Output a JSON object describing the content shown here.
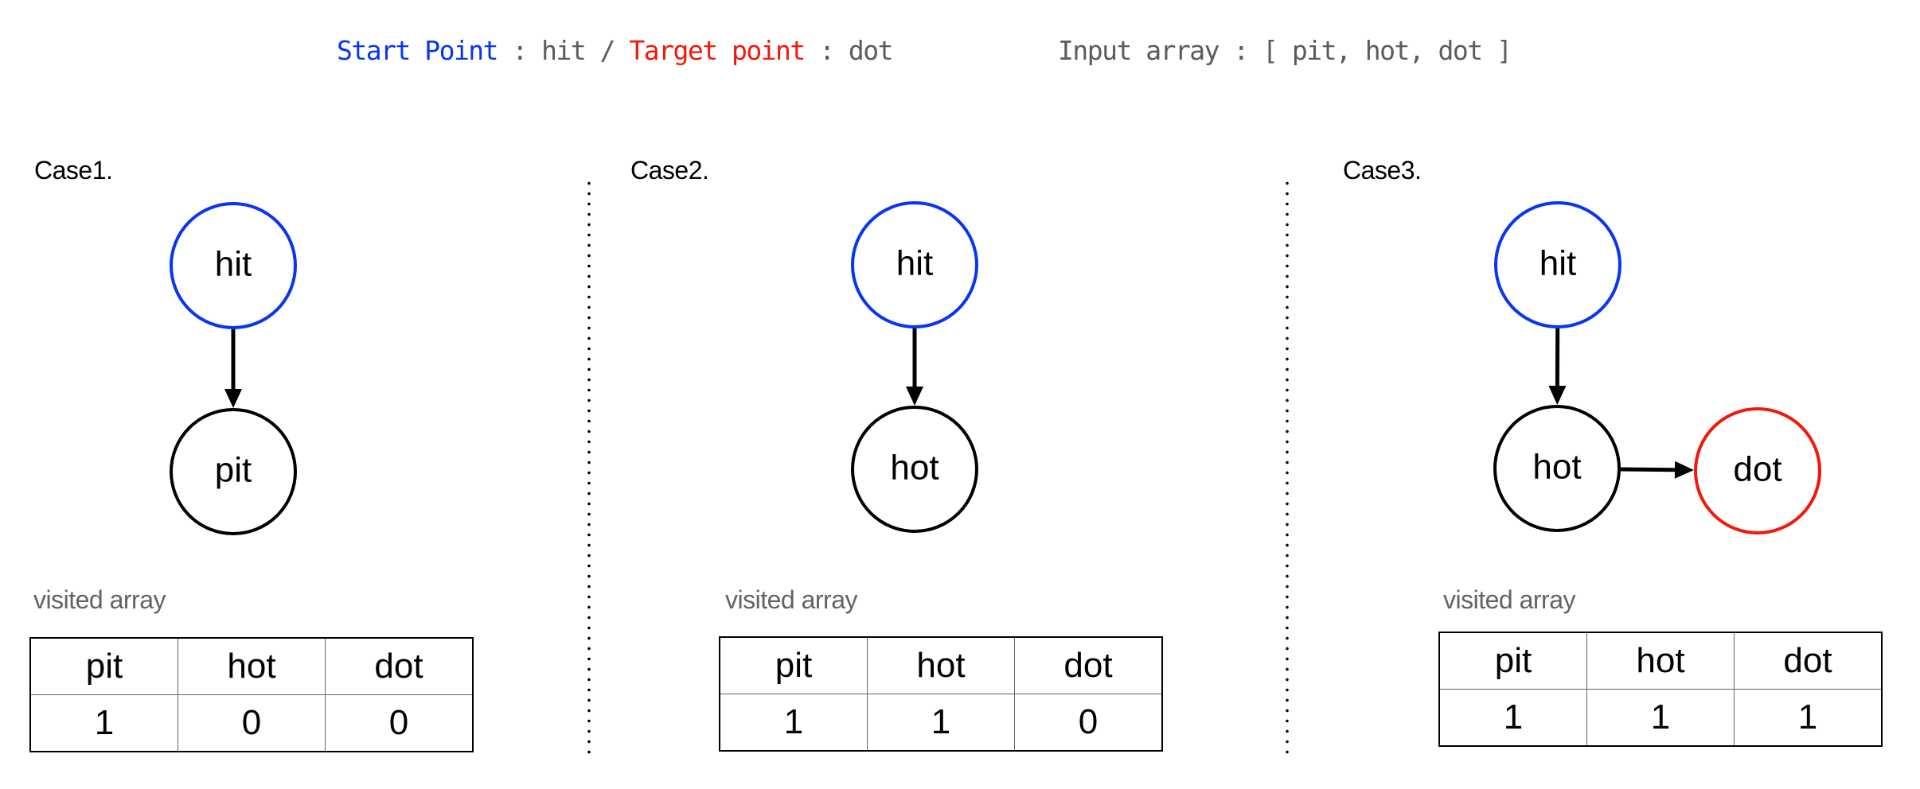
{
  "header": {
    "start_label": "Start Point",
    "start_sep": " : ",
    "start_value": "hit",
    "slash": " / ",
    "target_label": "Target point",
    "target_sep": " : ",
    "target_value": "dot",
    "input_label": "Input array : [ pit, hot, dot ]"
  },
  "colors": {
    "start": "#0a34f5",
    "target": "#f2180c",
    "normal": "#000000"
  },
  "visited_label": "visited array",
  "cases": [
    {
      "title": "Case1.",
      "nodes": [
        {
          "id": "hit",
          "label": "hit",
          "role": "start"
        },
        {
          "id": "pit",
          "label": "pit",
          "role": "normal"
        }
      ],
      "edges": [
        {
          "from": "hit",
          "to": "pit"
        }
      ],
      "visited": {
        "headers": [
          "pit",
          "hot",
          "dot"
        ],
        "values": [
          "1",
          "0",
          "0"
        ]
      }
    },
    {
      "title": "Case2.",
      "nodes": [
        {
          "id": "hit",
          "label": "hit",
          "role": "start"
        },
        {
          "id": "hot",
          "label": "hot",
          "role": "normal"
        }
      ],
      "edges": [
        {
          "from": "hit",
          "to": "hot"
        }
      ],
      "visited": {
        "headers": [
          "pit",
          "hot",
          "dot"
        ],
        "values": [
          "1",
          "1",
          "0"
        ]
      }
    },
    {
      "title": "Case3.",
      "nodes": [
        {
          "id": "hit",
          "label": "hit",
          "role": "start"
        },
        {
          "id": "hot",
          "label": "hot",
          "role": "normal"
        },
        {
          "id": "dot",
          "label": "dot",
          "role": "target"
        }
      ],
      "edges": [
        {
          "from": "hit",
          "to": "hot"
        },
        {
          "from": "hot",
          "to": "dot"
        }
      ],
      "visited": {
        "headers": [
          "pit",
          "hot",
          "dot"
        ],
        "values": [
          "1",
          "1",
          "1"
        ]
      }
    }
  ]
}
